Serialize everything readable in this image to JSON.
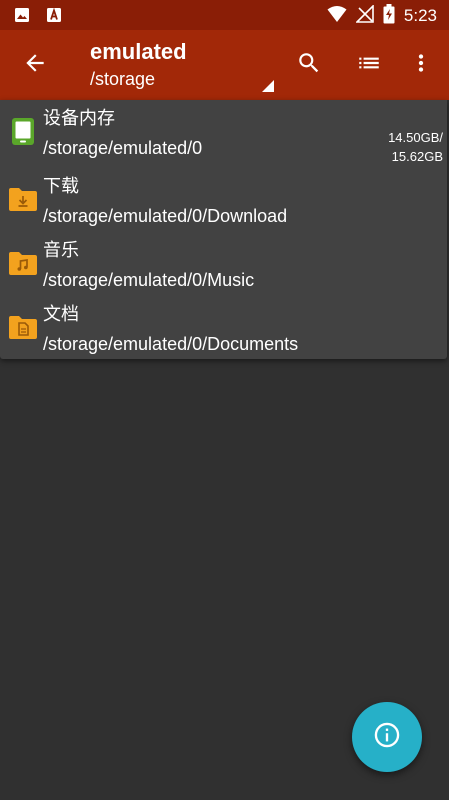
{
  "status_bar": {
    "time": "5:23",
    "left_icons": [
      "image-notification-icon",
      "font-notification-icon"
    ],
    "right_icons": [
      "wifi-icon",
      "no-signal-icon",
      "battery-charging-icon"
    ]
  },
  "toolbar": {
    "title": "emulated",
    "subtitle": "/storage",
    "back_icon": "arrow-back-icon",
    "actions": [
      "search-icon",
      "list-view-icon",
      "more-vert-icon"
    ]
  },
  "storage_list": {
    "items": [
      {
        "name": "设备内存",
        "path": "/storage/emulated/0",
        "size_used": "14.50GB/",
        "size_total": "15.62GB",
        "icon": "device-storage-icon"
      },
      {
        "name": "下载",
        "path": "/storage/emulated/0/Download",
        "icon": "download-folder-icon"
      },
      {
        "name": "音乐",
        "path": "/storage/emulated/0/Music",
        "icon": "music-folder-icon"
      },
      {
        "name": "文档",
        "path": "/storage/emulated/0/Documents",
        "icon": "documents-folder-icon"
      }
    ]
  },
  "fab": {
    "icon": "info-icon"
  },
  "colors": {
    "status_bar": "#8a1e06",
    "toolbar": "#a22808",
    "background": "#303030",
    "list_background": "#424242",
    "folder": "#f3a21e",
    "device_storage": "#5aa62a",
    "fab": "#26b0c8"
  }
}
